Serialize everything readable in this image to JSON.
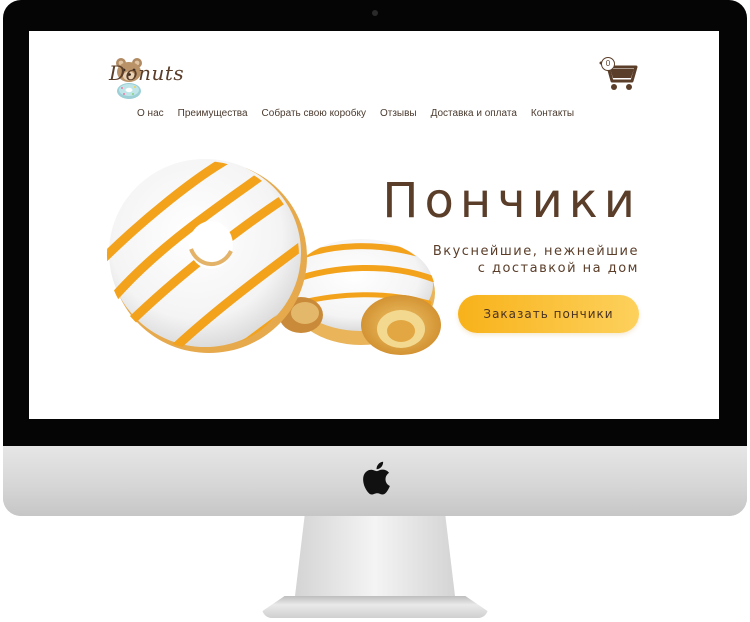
{
  "site": {
    "logo_text": "Donuts",
    "cart_count": "0"
  },
  "nav": {
    "items": [
      {
        "label": "О нас"
      },
      {
        "label": "Преимущества"
      },
      {
        "label": "Собрать свою коробку"
      },
      {
        "label": "Отзывы"
      },
      {
        "label": "Доставка и оплата"
      },
      {
        "label": "Контакты"
      }
    ]
  },
  "hero": {
    "title": "Пончики",
    "subtitle_line1": "Вкуснейшие, нежнейшие",
    "subtitle_line2": "с доставкой на дом",
    "cta_label": "Заказать пончики"
  },
  "colors": {
    "brand_brown": "#5b3e2a",
    "accent_orange": "#f8b21a",
    "glaze_white": "#ffffff",
    "stripe_orange": "#f3a21c"
  },
  "icons": {
    "cart": "shopping-cart-icon",
    "apple": "apple-logo-icon",
    "bear": "bear-mascot-icon"
  }
}
